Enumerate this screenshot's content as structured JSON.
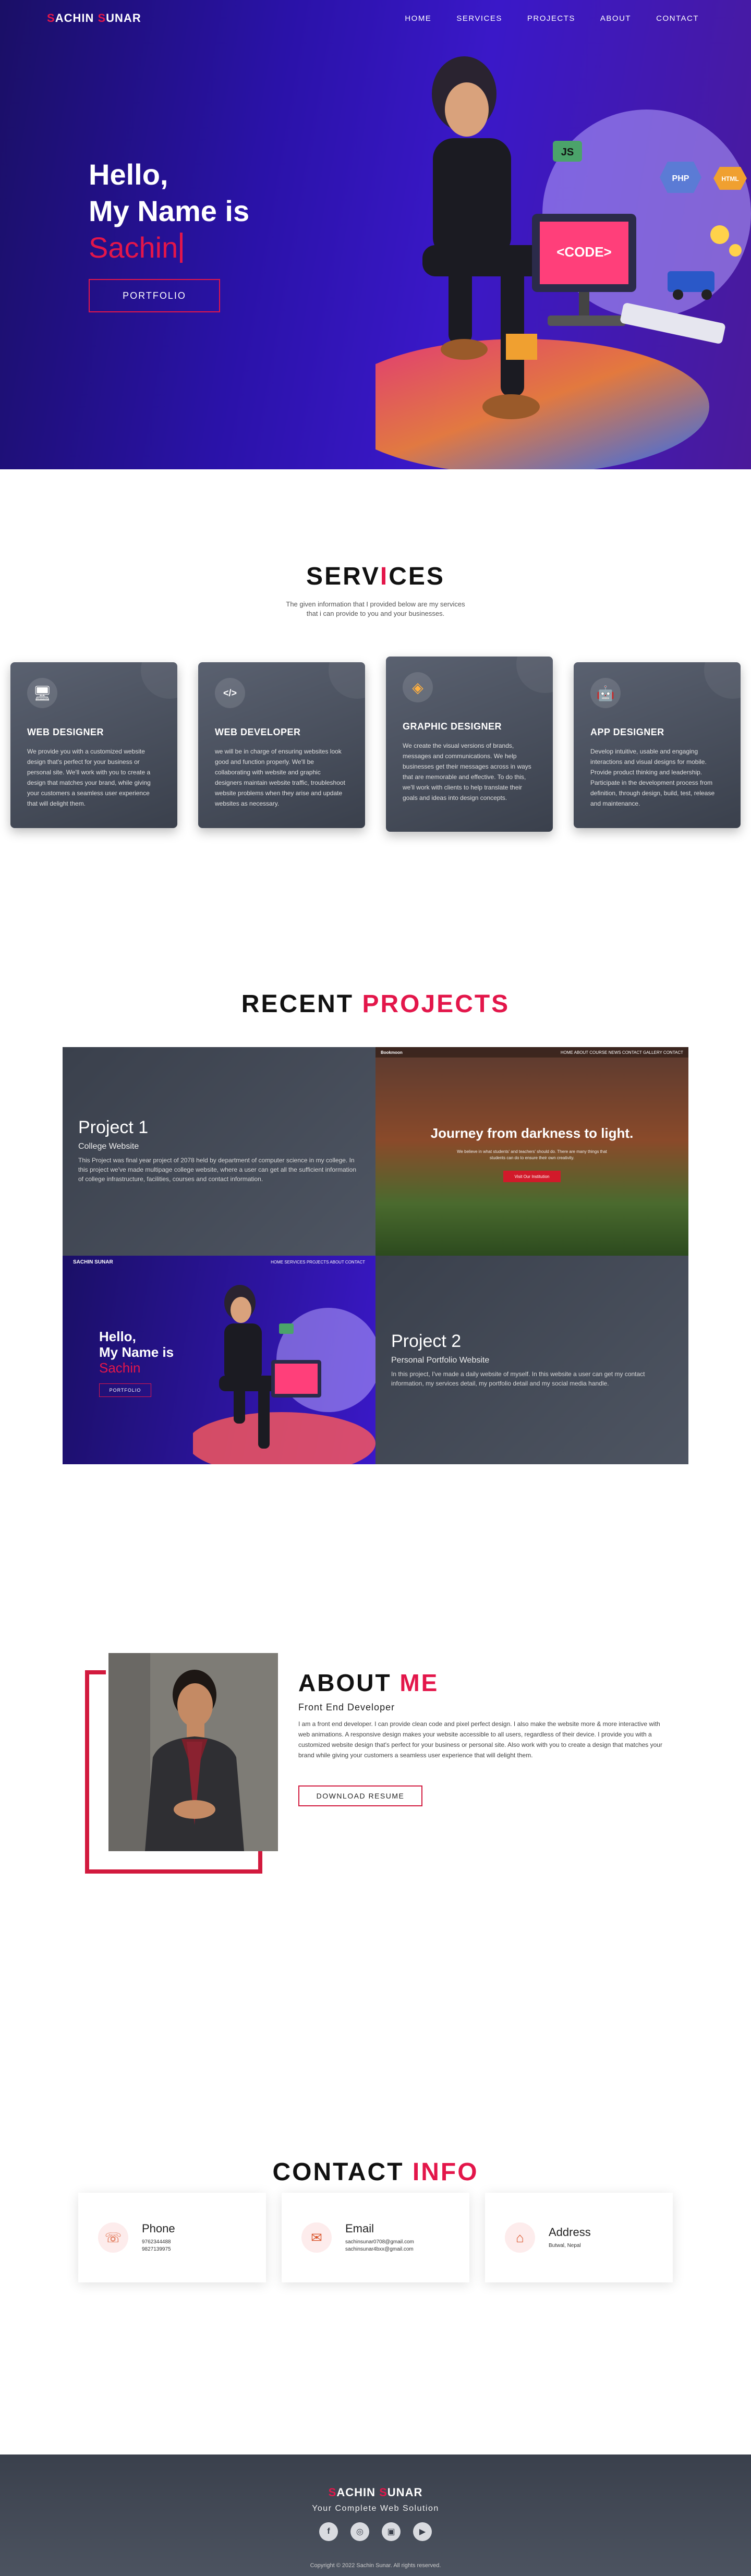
{
  "nav": {
    "logo_first": "S",
    "logo_mid": "ACHIN ",
    "logo_s2": "S",
    "logo_last": "UNAR",
    "links": [
      "HOME",
      "SERVICES",
      "PROJECTS",
      "ABOUT",
      "CONTACT"
    ]
  },
  "hero": {
    "line1": "Hello,",
    "line2": "My Name is",
    "typed_name": "Sachin",
    "button": "PORTFOLIO"
  },
  "services": {
    "title_a": "SERV",
    "title_b": "I",
    "title_c": "CES",
    "subtitle_1": "The given information that I provided below are my services",
    "subtitle_2": "that i can provide to you and your businesses.",
    "cards": [
      {
        "icon": "🖥",
        "title": "WEB DESIGNER",
        "desc": "We provide you with a customized website design that's perfect for your business or personal site. We'll work with you to create a design that matches your brand, while giving your customers a seamless user experience that will delight them."
      },
      {
        "icon": "</>",
        "title": "WEB DEVELOPER",
        "desc": "we will be in charge of ensuring websites look good and function properly. We'll be collaborating with website and graphic designers maintain website traffic, troubleshoot website problems when they arise and update websites as necessary."
      },
      {
        "icon": "◈",
        "title": "GRAPHIC DESIGNER",
        "desc": "We create the visual versions of brands, messages and communications. We help businesses get their messages across in ways that are memorable and effective. To do this, we'll work with clients to help translate their goals and ideas into design concepts."
      },
      {
        "icon": "🤖",
        "title": "APP DESIGNER",
        "desc": "Develop intuitive, usable and engaging interactions and visual designs for mobile. Provide product thinking and leadership. Participate in the development process from definition, through design, build, test, release and maintenance."
      }
    ]
  },
  "projects": {
    "title_a": "RECENT ",
    "title_b": "PROJECTS",
    "p1": {
      "name": "Project 1",
      "type": "College Website",
      "desc": "This Project was final year project of 2078 held by department of computer science in my college. In this project we've made multipage college website, where a user can get all the sufficient information of college infrastructure, facilities, courses and contact information."
    },
    "p2": {
      "name": "Project 2",
      "type": "Personal Portfolio Website",
      "desc": "In this project, I've made a daily website of myself. In this website a user can get my contact information, my services detail, my portfolio detail and my social media handle."
    },
    "shot1": {
      "brand": "Bookmoon",
      "menu": "HOME  ABOUT  COURSE  NEWS  CONTACT  GALLERY  CONTACT",
      "headline": "Journey from darkness to light.",
      "small": "We believe in what students' and teachers' should do. There are many things that students can do to ensure their own creativity.",
      "button": "Visit Our Institution"
    },
    "shot2": {
      "logo": "SACHIN SUNAR",
      "menu": "HOME    SERVICES    PROJECTS    ABOUT    CONTACT",
      "l1": "Hello,",
      "l2": "My Name is",
      "l3": "Sachin",
      "button": "PORTFOLIO"
    }
  },
  "about": {
    "title_a": "ABOUT ",
    "title_b": "ME",
    "role": "Front End Developer",
    "desc": "I am a front end developer. I can provide clean code and pixel perfect design. I also make the website more & more interactive with web animations. A responsive design makes your website accessible to all users, regardless of their device. I provide you with a customized website design that's perfect for your business or personal site. Also work with you to create a design that matches your brand while giving your customers a seamless user experience that will delight them.",
    "button": "DOWNLOAD RESUME"
  },
  "contact": {
    "title_a": "CONTACT ",
    "title_b": "INFO",
    "cards": [
      {
        "icon": "☏",
        "label": "Phone",
        "values": [
          "9762344488",
          "9827139975"
        ]
      },
      {
        "icon": "✉",
        "label": "Email",
        "values": [
          "sachinsunar0708@gmail.com",
          "sachinsunar4bxx@gmail.com"
        ]
      },
      {
        "icon": "⌂",
        "label": "Address",
        "values": [
          "Butwal, Nepal"
        ]
      }
    ]
  },
  "footer": {
    "tagline": "Your Complete Web Solution",
    "social": [
      "f",
      "◎",
      "▣",
      "▶"
    ],
    "copyright": "Copyright © 2022 Sachin Sunar. All rights reserved."
  }
}
